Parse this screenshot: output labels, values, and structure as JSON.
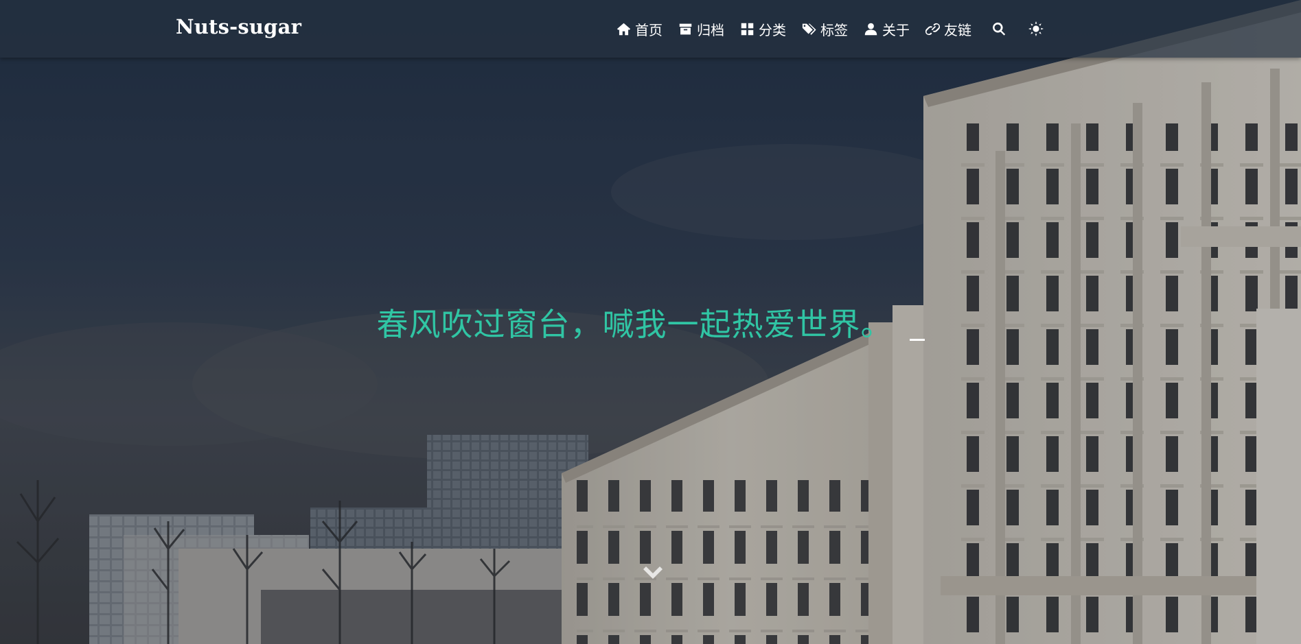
{
  "site": {
    "brand": "Nuts-sugar"
  },
  "nav": {
    "items": [
      {
        "label": "首页",
        "icon": "home-icon"
      },
      {
        "label": "归档",
        "icon": "archive-icon"
      },
      {
        "label": "分类",
        "icon": "category-icon"
      },
      {
        "label": "标签",
        "icon": "tags-icon"
      },
      {
        "label": "关于",
        "icon": "user-icon"
      },
      {
        "label": "友链",
        "icon": "link-icon"
      }
    ],
    "tools": [
      {
        "name": "search",
        "icon": "search-icon"
      },
      {
        "name": "theme-toggle",
        "icon": "sun-icon"
      }
    ]
  },
  "hero": {
    "subtitle": "春风吹过窗台，喊我一起热爱世界。",
    "scroll_icon": "chevron-down-icon"
  },
  "colors": {
    "navbar": "#243040",
    "subtitle_accent": "#30c5a4",
    "nav_text": "#ffffff"
  }
}
